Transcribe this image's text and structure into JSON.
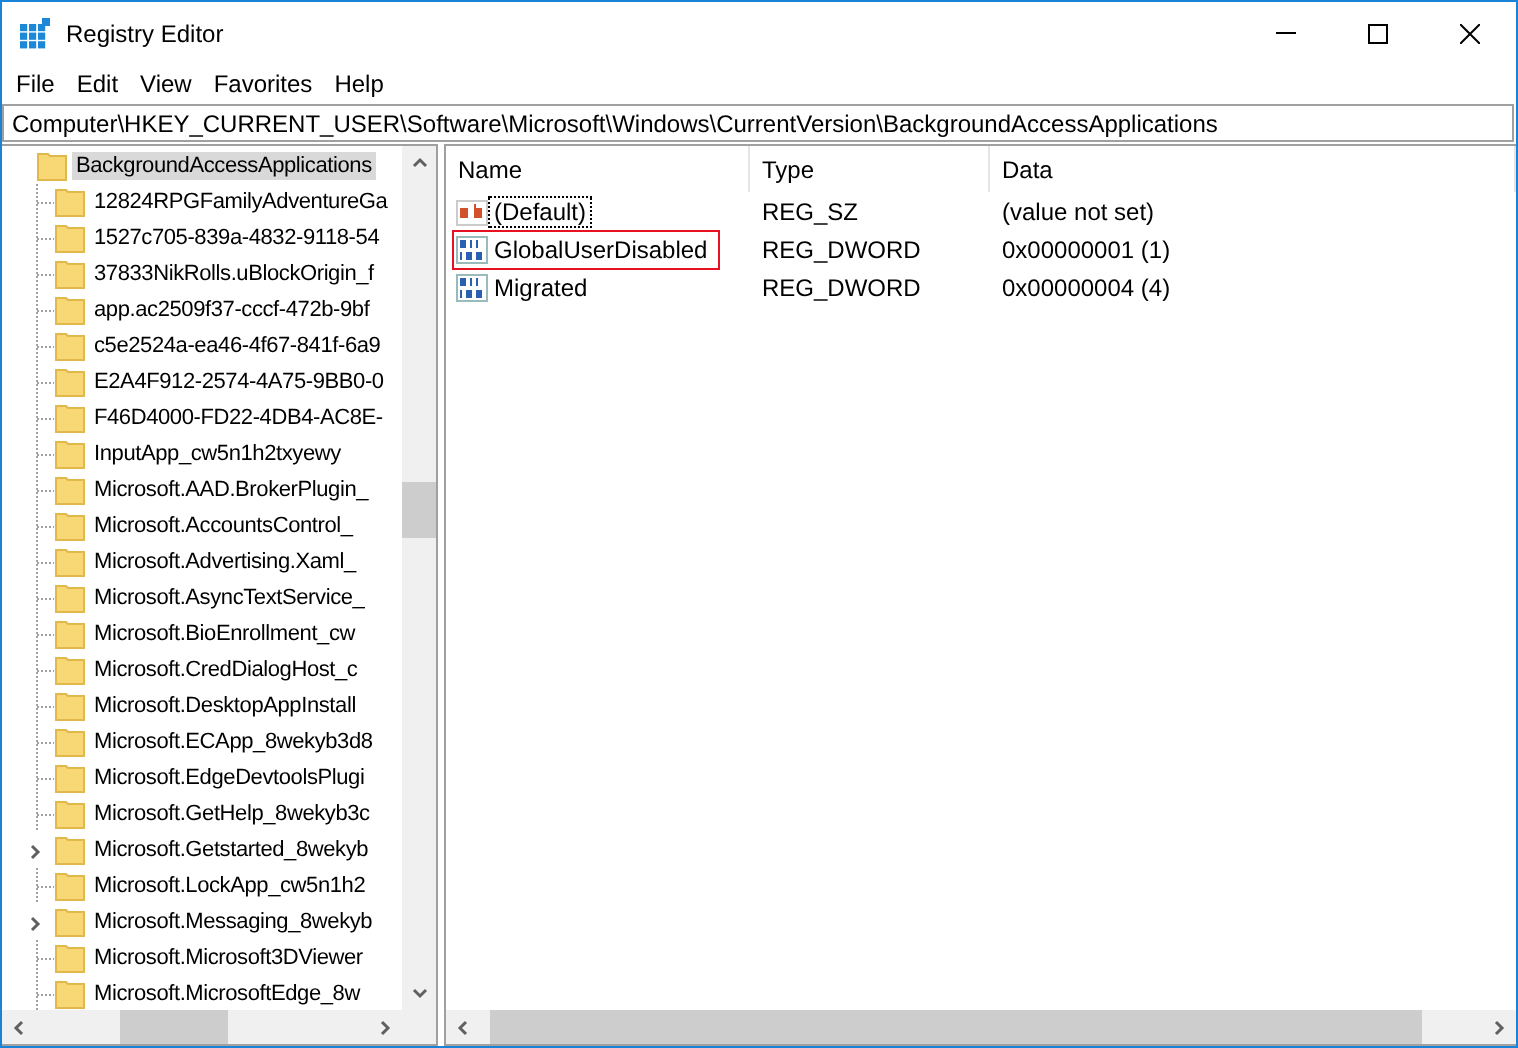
{
  "window": {
    "title": "Registry Editor"
  },
  "menu": [
    "File",
    "Edit",
    "View",
    "Favorites",
    "Help"
  ],
  "address": "Computer\\HKEY_CURRENT_USER\\Software\\Microsoft\\Windows\\CurrentVersion\\BackgroundAccessApplications",
  "tree": {
    "label": "BackgroundAccessApplications",
    "selected": true,
    "children": [
      {
        "label": "12824RPGFamilyAdventureGa",
        "selected": false,
        "expandable": false
      },
      {
        "label": "1527c705-839a-4832-9118-54",
        "selected": false,
        "expandable": false
      },
      {
        "label": "37833NikRolls.uBlockOrigin_f",
        "selected": false,
        "expandable": false
      },
      {
        "label": "app.ac2509f37-cccf-472b-9bf",
        "selected": false,
        "expandable": false
      },
      {
        "label": "c5e2524a-ea46-4f67-841f-6a9",
        "selected": false,
        "expandable": false
      },
      {
        "label": "E2A4F912-2574-4A75-9BB0-0",
        "selected": false,
        "expandable": false
      },
      {
        "label": "F46D4000-FD22-4DB4-AC8E-",
        "selected": false,
        "expandable": false
      },
      {
        "label": "InputApp_cw5n1h2txyewy",
        "selected": false,
        "expandable": false
      },
      {
        "label": "Microsoft.AAD.BrokerPlugin_",
        "selected": false,
        "expandable": false
      },
      {
        "label": "Microsoft.AccountsControl_",
        "selected": false,
        "expandable": false
      },
      {
        "label": "Microsoft.Advertising.Xaml_",
        "selected": false,
        "expandable": false
      },
      {
        "label": "Microsoft.AsyncTextService_",
        "selected": false,
        "expandable": false
      },
      {
        "label": "Microsoft.BioEnrollment_cw",
        "selected": false,
        "expandable": false
      },
      {
        "label": "Microsoft.CredDialogHost_c",
        "selected": false,
        "expandable": false
      },
      {
        "label": "Microsoft.DesktopAppInstall",
        "selected": false,
        "expandable": false
      },
      {
        "label": "Microsoft.ECApp_8wekyb3d8",
        "selected": false,
        "expandable": false
      },
      {
        "label": "Microsoft.EdgeDevtoolsPlugi",
        "selected": false,
        "expandable": false
      },
      {
        "label": "Microsoft.GetHelp_8wekyb3c",
        "selected": false,
        "expandable": false
      },
      {
        "label": "Microsoft.Getstarted_8wekyb",
        "selected": false,
        "expandable": true
      },
      {
        "label": "Microsoft.LockApp_cw5n1h2",
        "selected": false,
        "expandable": false
      },
      {
        "label": "Microsoft.Messaging_8wekyb",
        "selected": false,
        "expandable": true
      },
      {
        "label": "Microsoft.Microsoft3DViewer",
        "selected": false,
        "expandable": false
      },
      {
        "label": "Microsoft.MicrosoftEdge_8w",
        "selected": false,
        "expandable": false
      }
    ]
  },
  "columns": [
    "Name",
    "Type",
    "Data"
  ],
  "values": [
    {
      "kind": "string",
      "name": "(Default)",
      "type": "REG_SZ",
      "data": "(value not set)",
      "focused": true,
      "highlighted": false
    },
    {
      "kind": "dword",
      "name": "GlobalUserDisabled",
      "type": "REG_DWORD",
      "data": "0x00000001 (1)",
      "focused": false,
      "highlighted": true
    },
    {
      "kind": "dword",
      "name": "Migrated",
      "type": "REG_DWORD",
      "data": "0x00000004 (4)",
      "focused": false,
      "highlighted": false
    }
  ]
}
